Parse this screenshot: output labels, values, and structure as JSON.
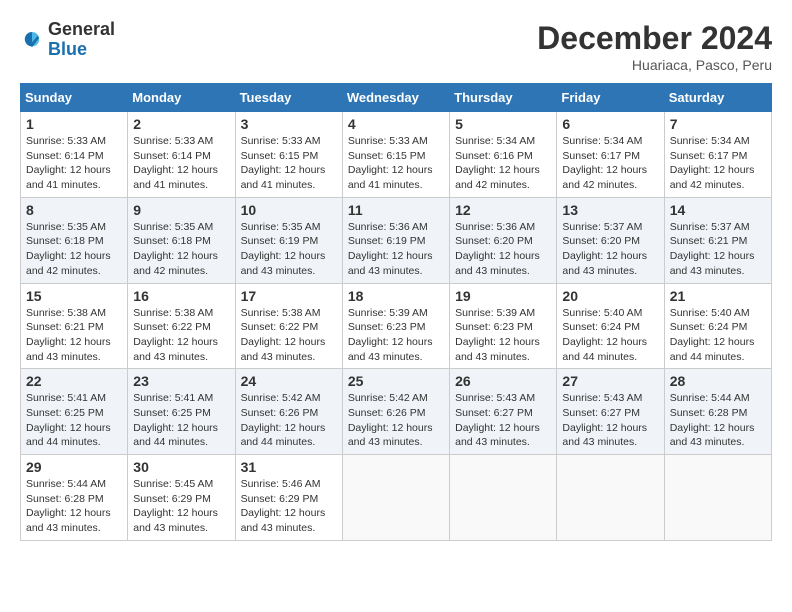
{
  "header": {
    "logo_general": "General",
    "logo_blue": "Blue",
    "month_title": "December 2024",
    "location": "Huariaca, Pasco, Peru"
  },
  "days_of_week": [
    "Sunday",
    "Monday",
    "Tuesday",
    "Wednesday",
    "Thursday",
    "Friday",
    "Saturday"
  ],
  "weeks": [
    [
      {
        "day": "1",
        "sunrise": "5:33 AM",
        "sunset": "6:14 PM",
        "daylight": "12 hours and 41 minutes."
      },
      {
        "day": "2",
        "sunrise": "5:33 AM",
        "sunset": "6:14 PM",
        "daylight": "12 hours and 41 minutes."
      },
      {
        "day": "3",
        "sunrise": "5:33 AM",
        "sunset": "6:15 PM",
        "daylight": "12 hours and 41 minutes."
      },
      {
        "day": "4",
        "sunrise": "5:33 AM",
        "sunset": "6:15 PM",
        "daylight": "12 hours and 41 minutes."
      },
      {
        "day": "5",
        "sunrise": "5:34 AM",
        "sunset": "6:16 PM",
        "daylight": "12 hours and 42 minutes."
      },
      {
        "day": "6",
        "sunrise": "5:34 AM",
        "sunset": "6:17 PM",
        "daylight": "12 hours and 42 minutes."
      },
      {
        "day": "7",
        "sunrise": "5:34 AM",
        "sunset": "6:17 PM",
        "daylight": "12 hours and 42 minutes."
      }
    ],
    [
      {
        "day": "8",
        "sunrise": "5:35 AM",
        "sunset": "6:18 PM",
        "daylight": "12 hours and 42 minutes."
      },
      {
        "day": "9",
        "sunrise": "5:35 AM",
        "sunset": "6:18 PM",
        "daylight": "12 hours and 42 minutes."
      },
      {
        "day": "10",
        "sunrise": "5:35 AM",
        "sunset": "6:19 PM",
        "daylight": "12 hours and 43 minutes."
      },
      {
        "day": "11",
        "sunrise": "5:36 AM",
        "sunset": "6:19 PM",
        "daylight": "12 hours and 43 minutes."
      },
      {
        "day": "12",
        "sunrise": "5:36 AM",
        "sunset": "6:20 PM",
        "daylight": "12 hours and 43 minutes."
      },
      {
        "day": "13",
        "sunrise": "5:37 AM",
        "sunset": "6:20 PM",
        "daylight": "12 hours and 43 minutes."
      },
      {
        "day": "14",
        "sunrise": "5:37 AM",
        "sunset": "6:21 PM",
        "daylight": "12 hours and 43 minutes."
      }
    ],
    [
      {
        "day": "15",
        "sunrise": "5:38 AM",
        "sunset": "6:21 PM",
        "daylight": "12 hours and 43 minutes."
      },
      {
        "day": "16",
        "sunrise": "5:38 AM",
        "sunset": "6:22 PM",
        "daylight": "12 hours and 43 minutes."
      },
      {
        "day": "17",
        "sunrise": "5:38 AM",
        "sunset": "6:22 PM",
        "daylight": "12 hours and 43 minutes."
      },
      {
        "day": "18",
        "sunrise": "5:39 AM",
        "sunset": "6:23 PM",
        "daylight": "12 hours and 43 minutes."
      },
      {
        "day": "19",
        "sunrise": "5:39 AM",
        "sunset": "6:23 PM",
        "daylight": "12 hours and 43 minutes."
      },
      {
        "day": "20",
        "sunrise": "5:40 AM",
        "sunset": "6:24 PM",
        "daylight": "12 hours and 44 minutes."
      },
      {
        "day": "21",
        "sunrise": "5:40 AM",
        "sunset": "6:24 PM",
        "daylight": "12 hours and 44 minutes."
      }
    ],
    [
      {
        "day": "22",
        "sunrise": "5:41 AM",
        "sunset": "6:25 PM",
        "daylight": "12 hours and 44 minutes."
      },
      {
        "day": "23",
        "sunrise": "5:41 AM",
        "sunset": "6:25 PM",
        "daylight": "12 hours and 44 minutes."
      },
      {
        "day": "24",
        "sunrise": "5:42 AM",
        "sunset": "6:26 PM",
        "daylight": "12 hours and 44 minutes."
      },
      {
        "day": "25",
        "sunrise": "5:42 AM",
        "sunset": "6:26 PM",
        "daylight": "12 hours and 43 minutes."
      },
      {
        "day": "26",
        "sunrise": "5:43 AM",
        "sunset": "6:27 PM",
        "daylight": "12 hours and 43 minutes."
      },
      {
        "day": "27",
        "sunrise": "5:43 AM",
        "sunset": "6:27 PM",
        "daylight": "12 hours and 43 minutes."
      },
      {
        "day": "28",
        "sunrise": "5:44 AM",
        "sunset": "6:28 PM",
        "daylight": "12 hours and 43 minutes."
      }
    ],
    [
      {
        "day": "29",
        "sunrise": "5:44 AM",
        "sunset": "6:28 PM",
        "daylight": "12 hours and 43 minutes."
      },
      {
        "day": "30",
        "sunrise": "5:45 AM",
        "sunset": "6:29 PM",
        "daylight": "12 hours and 43 minutes."
      },
      {
        "day": "31",
        "sunrise": "5:46 AM",
        "sunset": "6:29 PM",
        "daylight": "12 hours and 43 minutes."
      },
      null,
      null,
      null,
      null
    ]
  ]
}
